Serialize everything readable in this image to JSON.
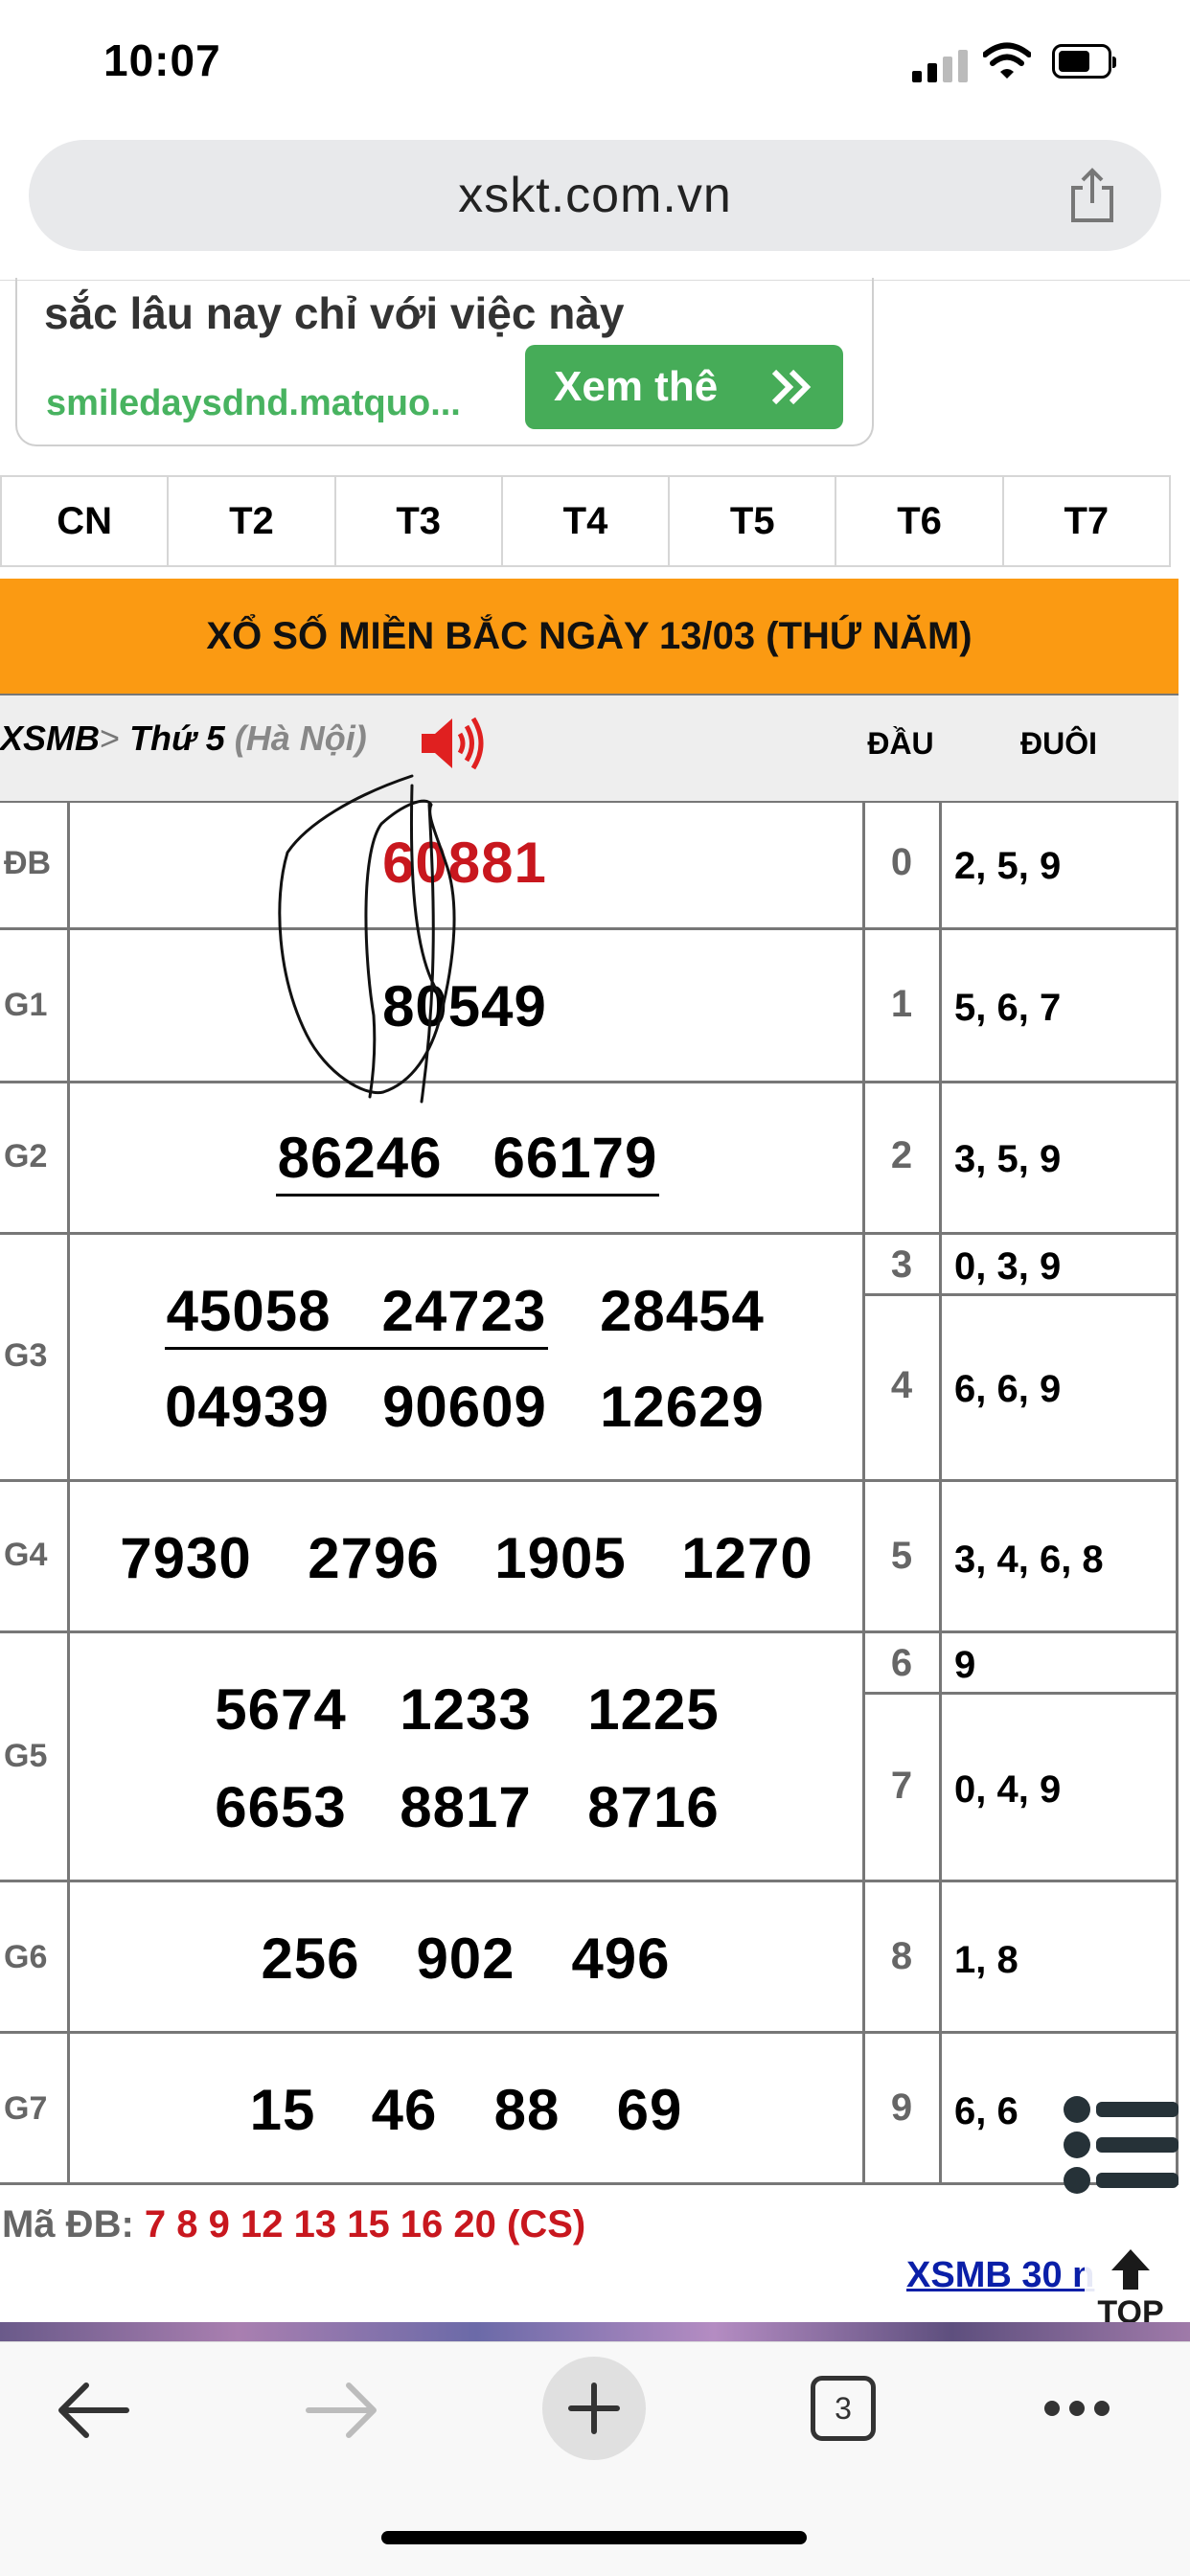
{
  "status_bar": {
    "time": "10:07"
  },
  "browser": {
    "url": "xskt.com.vn",
    "tabs_count": "3"
  },
  "ad": {
    "title": "sắc lâu nay chỉ với việc này",
    "domain": "smiledaysdnd.matquo...",
    "button_label": "Xem thê"
  },
  "day_tabs": [
    "CN",
    "T2",
    "T3",
    "T4",
    "T5",
    "T6",
    "T7"
  ],
  "results": {
    "header": "XỔ SỐ MIỀN BẮC NGÀY 13/03 (THỨ NĂM)",
    "breadcrumb_root": "XSMB",
    "breadcrumb_sep": ">",
    "breadcrumb_day": "Thứ 5",
    "breadcrumb_city": "(Hà Nội)",
    "col_dau": "ĐẦU",
    "col_duoi": "ĐUÔI",
    "prizes": {
      "db": {
        "label": "ĐB",
        "numbers": [
          "60881"
        ]
      },
      "g1": {
        "label": "G1",
        "numbers": [
          "80549"
        ]
      },
      "g2": {
        "label": "G2",
        "numbers": [
          "86246",
          "66179"
        ]
      },
      "g3": {
        "label": "G3",
        "numbers": [
          "45058",
          "24723",
          "28454",
          "04939",
          "90609",
          "12629"
        ]
      },
      "g4": {
        "label": "G4",
        "numbers": [
          "7930",
          "2796",
          "1905",
          "1270"
        ]
      },
      "g5": {
        "label": "G5",
        "numbers": [
          "5674",
          "1233",
          "1225",
          "6653",
          "8817",
          "8716"
        ]
      },
      "g6": {
        "label": "G6",
        "numbers": [
          "256",
          "902",
          "496"
        ]
      },
      "g7": {
        "label": "G7",
        "numbers": [
          "15",
          "46",
          "88",
          "69"
        ]
      }
    },
    "loto": [
      {
        "dau": "0",
        "duoi": "2, 5, 9"
      },
      {
        "dau": "1",
        "duoi": "5, 6, 7"
      },
      {
        "dau": "2",
        "duoi": "3, 5, 9"
      },
      {
        "dau": "3",
        "duoi": "0, 3, 9"
      },
      {
        "dau": "4",
        "duoi": "6, 6, 9"
      },
      {
        "dau": "5",
        "duoi": "3, 4, 6, 8"
      },
      {
        "dau": "6",
        "duoi": "9"
      },
      {
        "dau": "7",
        "duoi": "0, 4, 9"
      },
      {
        "dau": "8",
        "duoi": "1, 8"
      },
      {
        "dau": "9",
        "duoi": "6, 6"
      }
    ],
    "ma_db_label": "Mã ĐB:",
    "ma_db_value": "7 8 9 12 13 15 16 20 (CS)",
    "more_link": "XSMB 30 n",
    "top_label": "TOP"
  },
  "colors": {
    "orange_header": "#fb9a12",
    "red": "#c8171e",
    "ad_green": "#46ac58"
  },
  "icons": [
    "signal-icon",
    "wifi-icon",
    "battery-icon",
    "share-icon",
    "speaker-icon",
    "double-chevron-icon",
    "menu-icon",
    "arrow-up-icon",
    "back-icon",
    "forward-icon",
    "new-tab-icon",
    "tabs-icon",
    "more-icon"
  ]
}
